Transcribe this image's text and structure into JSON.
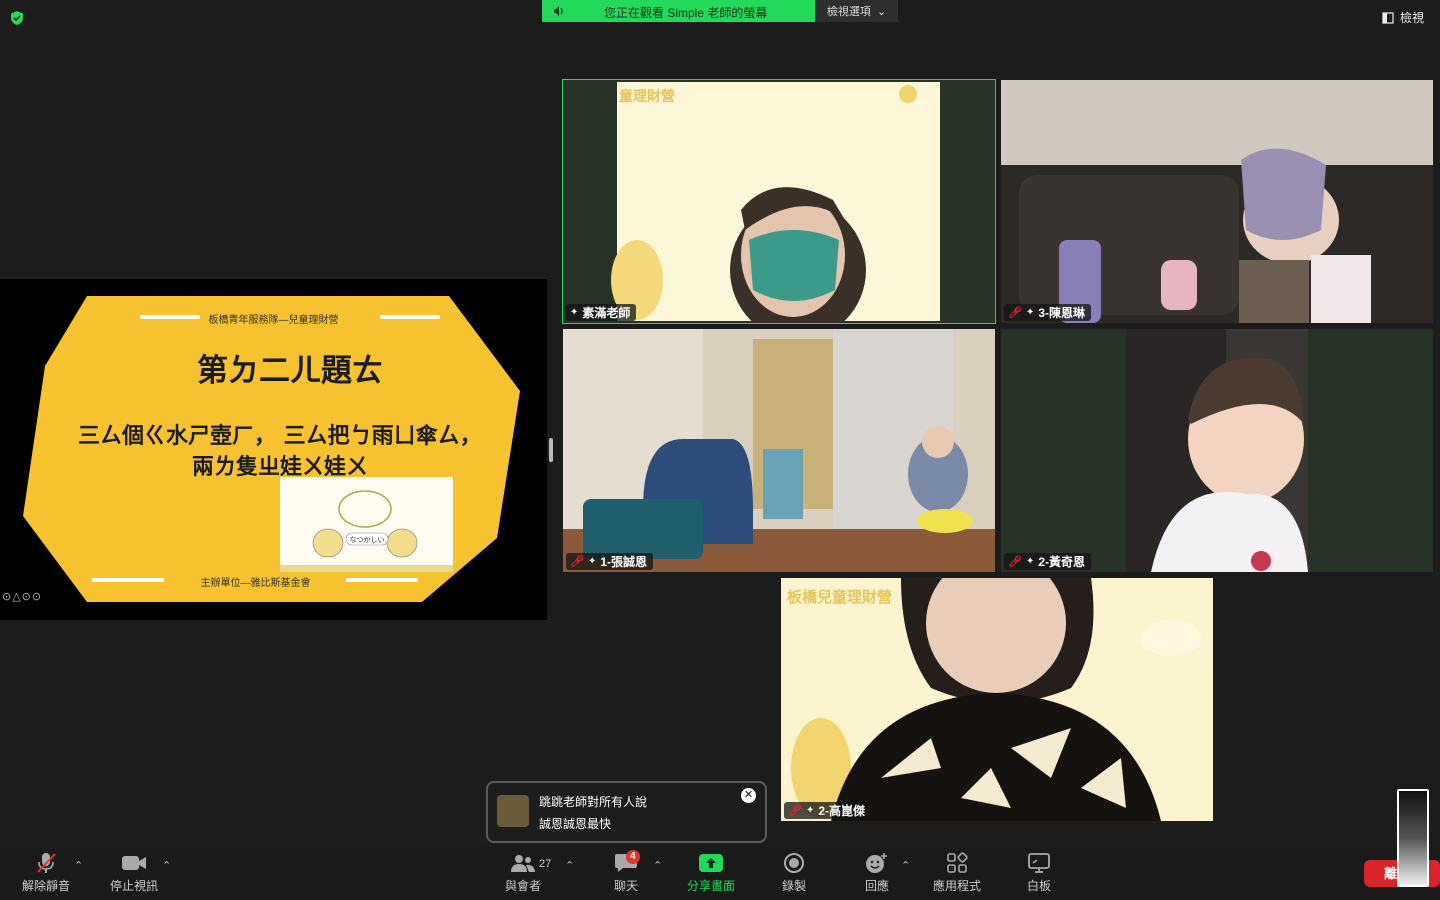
{
  "top": {
    "share_banner": "您正在觀看 Simple 老師的螢幕",
    "view_options": "檢視選項",
    "view_button": "檢視"
  },
  "slide": {
    "header": "板橋青年服務隊—兒童理財營",
    "title": "第ㄉ二ㄦ題ㄊ",
    "line1": "三ㄙ個ㄍ水ㄕ壺ㄏ， 三ㄙ把ㄅ雨ㄩ傘ㄙ，",
    "line2": "兩ㄌ隻ㄓ娃ㄨ娃ㄨ",
    "image_text": "なつかしい",
    "footer": "主辦單位—雅比斯基金會",
    "nav": "⊙△⊙⊙"
  },
  "participants": [
    {
      "name": "素滿老師",
      "muted": false,
      "active": true,
      "banner": "童理財營"
    },
    {
      "name": "3-陳恩琳",
      "muted": true,
      "active": false
    },
    {
      "name": "1-張誠恩",
      "muted": true,
      "active": false
    },
    {
      "name": "2-黃奇恩",
      "muted": true,
      "active": false
    },
    {
      "name": "2-高崑傑",
      "muted": true,
      "active": false,
      "banner": "板橋兒童理財營"
    }
  ],
  "chat_toast": {
    "from": "跳跳老師對所有人說",
    "message": "誠恩誠恩最快"
  },
  "toolbar": {
    "unmute": "解除靜音",
    "stop_video": "停止視訊",
    "participants": "與會者",
    "participant_count": "27",
    "chat": "聊天",
    "chat_badge": "4",
    "share_screen": "分享畫面",
    "record": "錄製",
    "reactions": "回應",
    "apps": "應用程式",
    "whiteboard": "白板",
    "leave": "離"
  },
  "colors": {
    "accent_green": "#23d959",
    "slide_yellow": "#f6c22f",
    "leave_red": "#d9252a"
  }
}
